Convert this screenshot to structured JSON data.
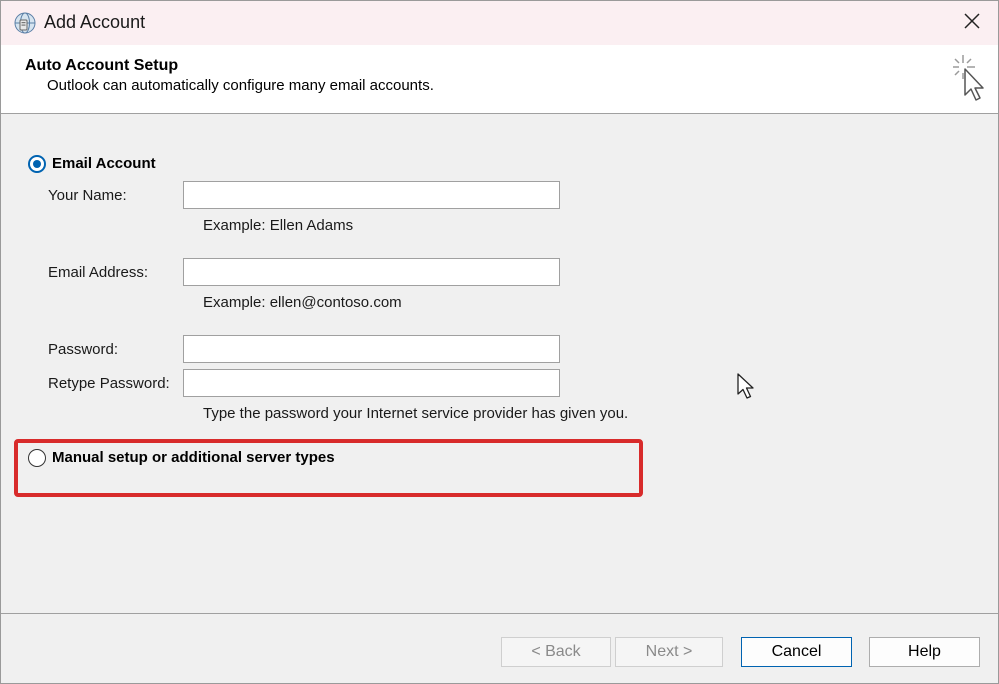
{
  "window": {
    "title": "Add Account",
    "app_icon": "outlook-account-icon",
    "close_icon": "close-icon"
  },
  "header": {
    "title": "Auto Account Setup",
    "subtitle": "Outlook can automatically configure many email accounts.",
    "icon": "wizard-cursor-icon"
  },
  "email_account": {
    "label": "Email Account",
    "selected": true,
    "fields": {
      "name": {
        "label": "Your Name:",
        "value": "",
        "hint": "Example: Ellen Adams"
      },
      "email": {
        "label": "Email Address:",
        "value": "",
        "hint": "Example: ellen@contoso.com"
      },
      "password": {
        "label": "Password:",
        "value": ""
      },
      "retype_password": {
        "label": "Retype Password:",
        "value": "",
        "hint": "Type the password your Internet service provider has given you."
      }
    }
  },
  "manual_setup": {
    "label": "Manual setup or additional server types",
    "selected": false
  },
  "buttons": {
    "back": "< Back",
    "next": "Next >",
    "cancel": "Cancel",
    "help": "Help"
  },
  "colors": {
    "title_bar": "#fbeff2",
    "accent": "#0063b1",
    "highlight": "#d82b2b"
  }
}
